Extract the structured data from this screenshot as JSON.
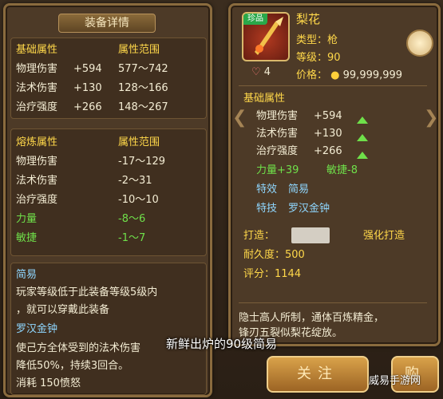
{
  "left": {
    "title": "装备详情",
    "base_header": [
      "基础属性",
      "属性范围"
    ],
    "base_rows": [
      {
        "name": "物理伤害",
        "val": "+594",
        "range": "577～742"
      },
      {
        "name": "法术伤害",
        "val": "+130",
        "range": "128～166"
      },
      {
        "name": "治疗强度",
        "val": "+266",
        "range": "148～267"
      }
    ],
    "forge_header": [
      "熔炼属性",
      "属性范围"
    ],
    "forge_rows": [
      {
        "name": "物理伤害",
        "range": "-17～129"
      },
      {
        "name": "法术伤害",
        "range": "-2～31"
      },
      {
        "name": "治疗强度",
        "range": "-10～10"
      },
      {
        "name": "力量",
        "range": "-8～6"
      },
      {
        "name": "敏捷",
        "range": "-1～7"
      }
    ],
    "effect_title": "简易",
    "effect_desc_1": "玩家等级低于此装备等级5级内",
    "effect_desc_2": "，就可以穿戴此装备",
    "skill_title": "罗汉金钟",
    "skill_desc_1": "使己方全体受到的法术伤害",
    "skill_desc_2": "降低50%，持续3回合。",
    "skill_cost": "消耗  150愤怒"
  },
  "right": {
    "rare_tag": "珍品",
    "name": "梨花",
    "type": "类型：枪",
    "level": "等级：90",
    "likes": "4",
    "price_label": "价格：",
    "price_value": "99,999,999",
    "base_header": "基础属性",
    "rows": [
      {
        "name": "物理伤害",
        "val": "+594"
      },
      {
        "name": "法术伤害",
        "val": "+130"
      },
      {
        "name": "治疗强度",
        "val": "+266"
      }
    ],
    "bonus_1": "力量+39",
    "bonus_2": "敏捷-8",
    "effect_label": "特效",
    "effect_value": "简易",
    "skill_label": "特技",
    "skill_value": "罗汉金钟",
    "forge_label": "打造：",
    "forge_action": "强化打造",
    "durability": "耐久度：500",
    "score": "评分：1144",
    "desc_1": "隐士高人所制，通体百炼精金，",
    "desc_2": "锋刃五裂似梨花绽放。"
  },
  "buttons": {
    "follow": "关注",
    "buy": "购"
  },
  "caption": "新鲜出炉的90级简易",
  "watermark": "威易手游网",
  "colors": {
    "gold": "#ffd84a",
    "green": "#6fe04a",
    "blue": "#8fd7ff"
  }
}
